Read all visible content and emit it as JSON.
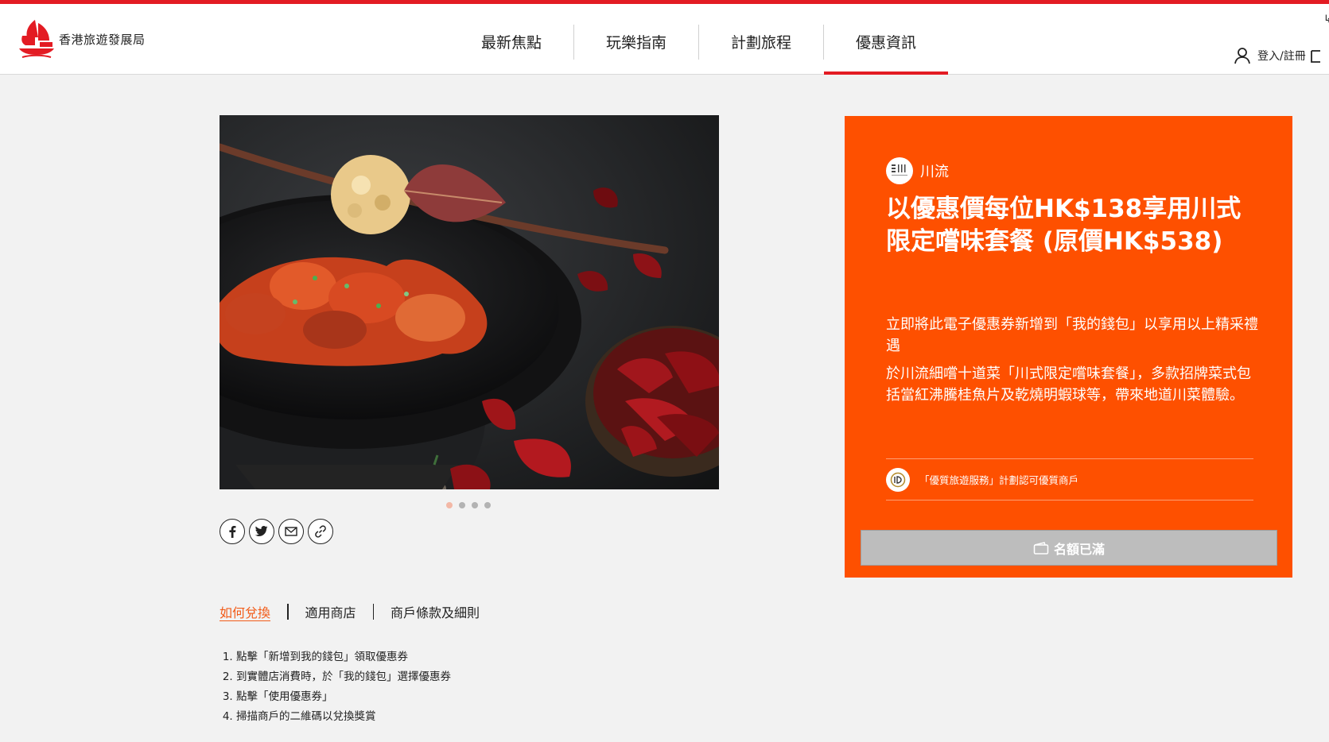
{
  "colors": {
    "brand_red": "#e31b23",
    "offer_orange": "#fe5000",
    "active_tab_orange": "#f25c19",
    "disabled_button": "#bdbdbd"
  },
  "header": {
    "logo_text": "香港旅遊發展局",
    "nav": [
      {
        "label": "最新焦點",
        "active": false
      },
      {
        "label": "玩樂指南",
        "active": false
      },
      {
        "label": "計劃旅程",
        "active": false
      },
      {
        "label": "優惠資訊",
        "active": true
      }
    ],
    "login_label": "登入/註冊",
    "edge_glyph": "↳",
    "icons": [
      "user-icon",
      "cart-icon"
    ]
  },
  "gallery": {
    "slide_count": 4,
    "active_slide": 1
  },
  "share": {
    "buttons": [
      "facebook-icon",
      "twitter-icon",
      "email-icon",
      "link-icon"
    ]
  },
  "tabs": [
    {
      "label": "如何兌換",
      "active": true
    },
    {
      "label": "適用商店",
      "active": false
    },
    {
      "label": "商戶條款及細則",
      "active": false
    }
  ],
  "steps": [
    "點擊「新增到我的錢包」領取優惠券",
    "到實體店消費時，於「我的錢包」選擇優惠券",
    "點擊「使用優惠券」",
    "掃描商戶的二維碼以兌換獎賞"
  ],
  "offer": {
    "merchant_name": "川流",
    "title": "以優惠價每位HK$138享用川式限定嚐味套餐 (原價HK$538)",
    "description_1": "立即將此電子優惠券新增到「我的錢包」以享用以上精采禮遇",
    "description_2": "於川流細嚐十道菜「川式限定嚐味套餐」，多款招牌菜式包括當紅沸騰桂魚片及乾燒明蝦球等，帶來地道川菜體驗。",
    "qts_text": "「優質旅遊服務」計劃認可優質商戶",
    "button_label": "名額已滿",
    "button_icon": "wallet-icon"
  }
}
